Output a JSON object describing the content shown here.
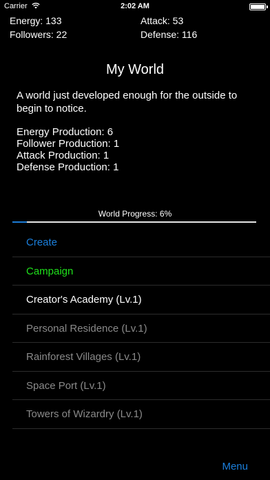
{
  "status_bar": {
    "carrier": "Carrier",
    "time": "2:02 AM"
  },
  "stats": {
    "energy": "Energy: 133",
    "attack": "Attack: 53",
    "followers": "Followers: 22",
    "defense": "Defense: 116"
  },
  "world": {
    "title": "My World",
    "description": "A world just developed enough for the outside to begin to notice.",
    "production": [
      "Energy Production: 6",
      "Follower Production: 1",
      "Attack Production: 1",
      "Defense Production: 1"
    ]
  },
  "progress": {
    "label": "World Progress: 6%",
    "value": 0.06,
    "color": "#1c7cd6"
  },
  "menu_items": [
    {
      "label": "Create",
      "color": "#1b7fdc"
    },
    {
      "label": "Campaign",
      "color": "#1fe01b"
    },
    {
      "label": "Creator's Academy (Lv.1)",
      "color": "#ffffff"
    },
    {
      "label": "Personal Residence (Lv.1)",
      "color": "#8a8a8a"
    },
    {
      "label": "Rainforest Villages (Lv.1)",
      "color": "#8a8a8a"
    },
    {
      "label": "Space Port (Lv.1)",
      "color": "#8a8a8a"
    },
    {
      "label": "Towers of Wizardry (Lv.1)",
      "color": "#8a8a8a"
    }
  ],
  "menu_button": "Menu"
}
